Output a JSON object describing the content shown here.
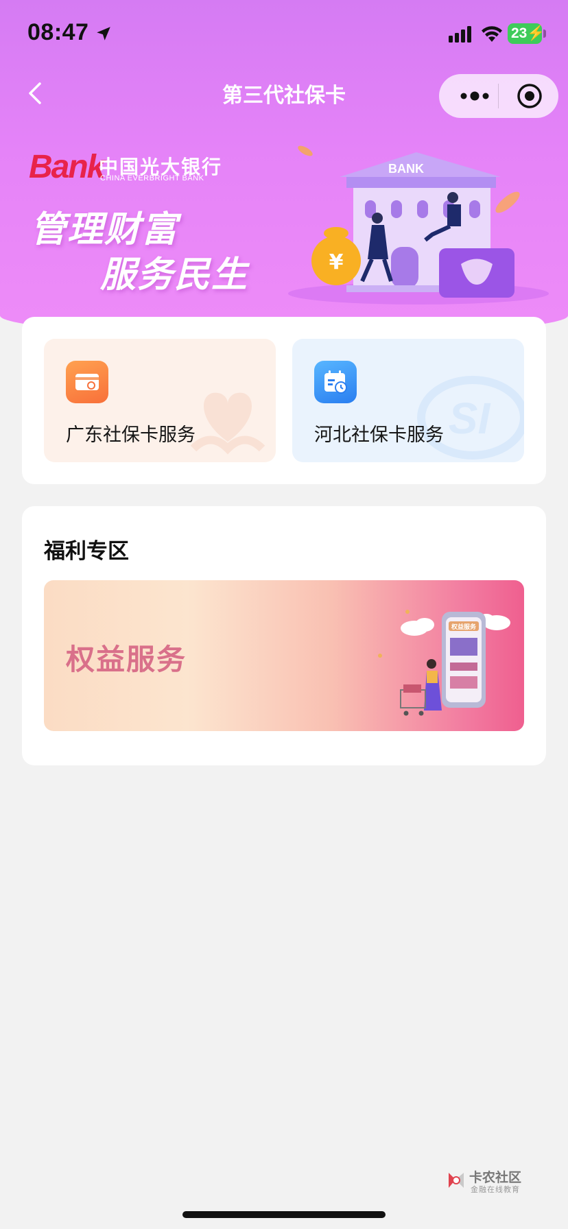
{
  "status_bar": {
    "time": "08:47",
    "battery": "23"
  },
  "nav": {
    "title": "第三代社保卡",
    "icons": [
      "back-icon",
      "more-icon",
      "close-miniprogram-icon"
    ]
  },
  "banner": {
    "bank_name_cn": "中国光大银行",
    "bank_name_en": "CHINA EVERBRIGHT BANK",
    "bank_logo_mark": "Bank",
    "slogan_line1": "管理财富",
    "slogan_line2": "服务民生",
    "building_sign": "BANK"
  },
  "services": [
    {
      "label": "广东社保卡服务",
      "icon": "social-card-icon",
      "color": "#f8703a"
    },
    {
      "label": "河北社保卡服务",
      "icon": "calendar-clock-icon",
      "color": "#2a7ef0"
    }
  ],
  "welfare": {
    "title": "福利专区",
    "banner_label": "权益服务",
    "phone_sign": "权益服务"
  },
  "watermark": {
    "name": "卡农社区",
    "subtitle": "金融在线教育"
  },
  "colors": {
    "header_gradient": "#e583f8",
    "page_bg": "#f2f2f2",
    "logo_red": "#e8234a"
  }
}
